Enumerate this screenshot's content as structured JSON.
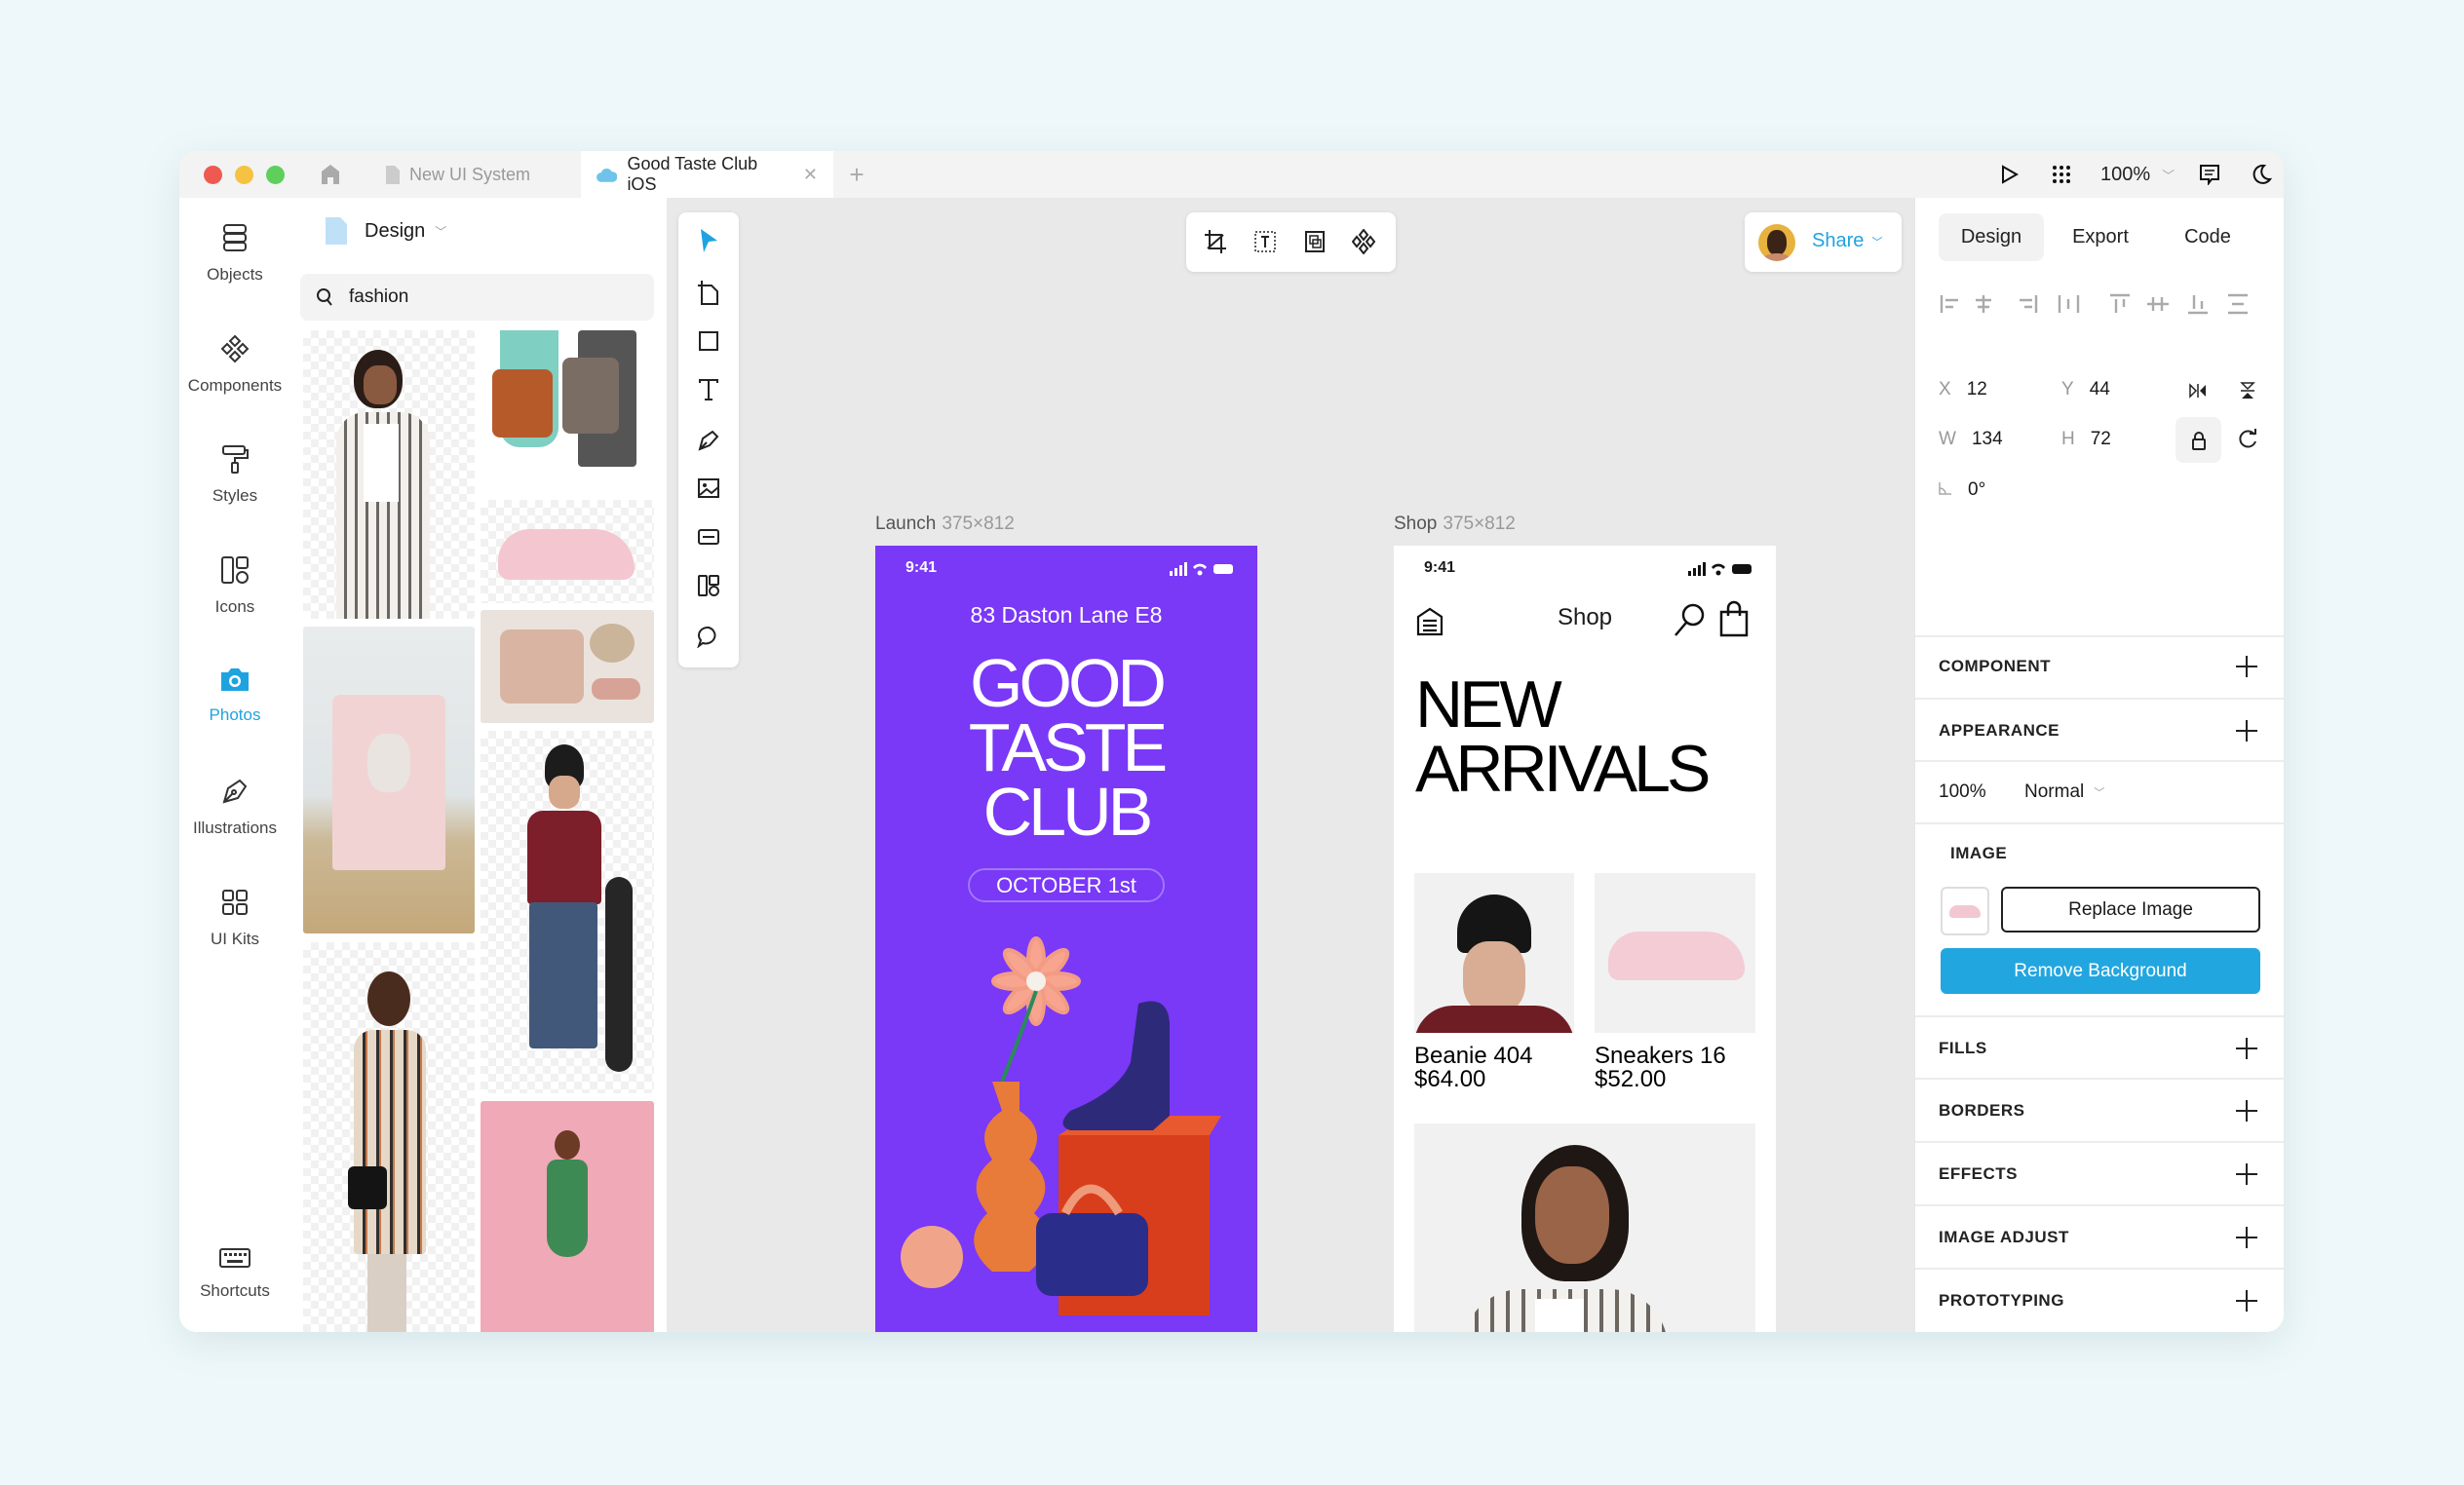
{
  "titlebar": {
    "tabs": [
      {
        "label": "New UI System",
        "icon": "document-icon",
        "active": false
      },
      {
        "label": "Good Taste Club iOS",
        "icon": "cloud-icon",
        "active": true
      }
    ],
    "zoom": "100%"
  },
  "rail": {
    "items": [
      {
        "label": "Objects",
        "icon": "database-icon"
      },
      {
        "label": "Components",
        "icon": "components-icon"
      },
      {
        "label": "Styles",
        "icon": "paint-roller-icon"
      },
      {
        "label": "Icons",
        "icon": "icons-icon"
      },
      {
        "label": "Photos",
        "icon": "camera-icon",
        "active": true
      },
      {
        "label": "Illustrations",
        "icon": "pen-nib-icon"
      },
      {
        "label": "UI Kits",
        "icon": "grid-icon"
      }
    ],
    "shortcuts": "Shortcuts",
    "accent": "#1fa3e0"
  },
  "assets": {
    "page": "Design",
    "search_value": "fashion"
  },
  "canvas": {
    "frames": [
      {
        "name": "Launch",
        "size": "375×812"
      },
      {
        "name": "Shop",
        "size": "375×812"
      }
    ],
    "share_label": "Share",
    "launch": {
      "time": "9:41",
      "address": "83 Daston Lane E8",
      "title_lines": [
        "GOOD",
        "TASTE",
        "CLUB"
      ],
      "date": "OCTOBER 1st",
      "bg": "#7a38f7"
    },
    "shop": {
      "time": "9:41",
      "nav_title": "Shop",
      "headline_lines": [
        "NEW",
        "ARRIVALS"
      ],
      "products": [
        {
          "name": "Beanie 404",
          "price": "$64.00"
        },
        {
          "name": "Sneakers 16",
          "price": "$52.00"
        }
      ]
    }
  },
  "inspector": {
    "tabs": [
      "Design",
      "Export",
      "Code"
    ],
    "active_tab": "Design",
    "x": "12",
    "y": "44",
    "w": "134",
    "h": "72",
    "rotation": "0°",
    "labels": {
      "x": "X",
      "y": "Y",
      "w": "W",
      "h": "H"
    },
    "sections": {
      "component": "COMPONENT",
      "appearance": "APPEARANCE",
      "image": "IMAGE",
      "fills": "FILLS",
      "borders": "BORDERS",
      "effects": "EFFECTS",
      "image_adjust": "IMAGE ADJUST",
      "prototyping": "PROTOTYPING"
    },
    "opacity": "100%",
    "blend_mode": "Normal",
    "replace_image": "Replace Image",
    "remove_background": "Remove Background",
    "accent": "#22a6df"
  }
}
